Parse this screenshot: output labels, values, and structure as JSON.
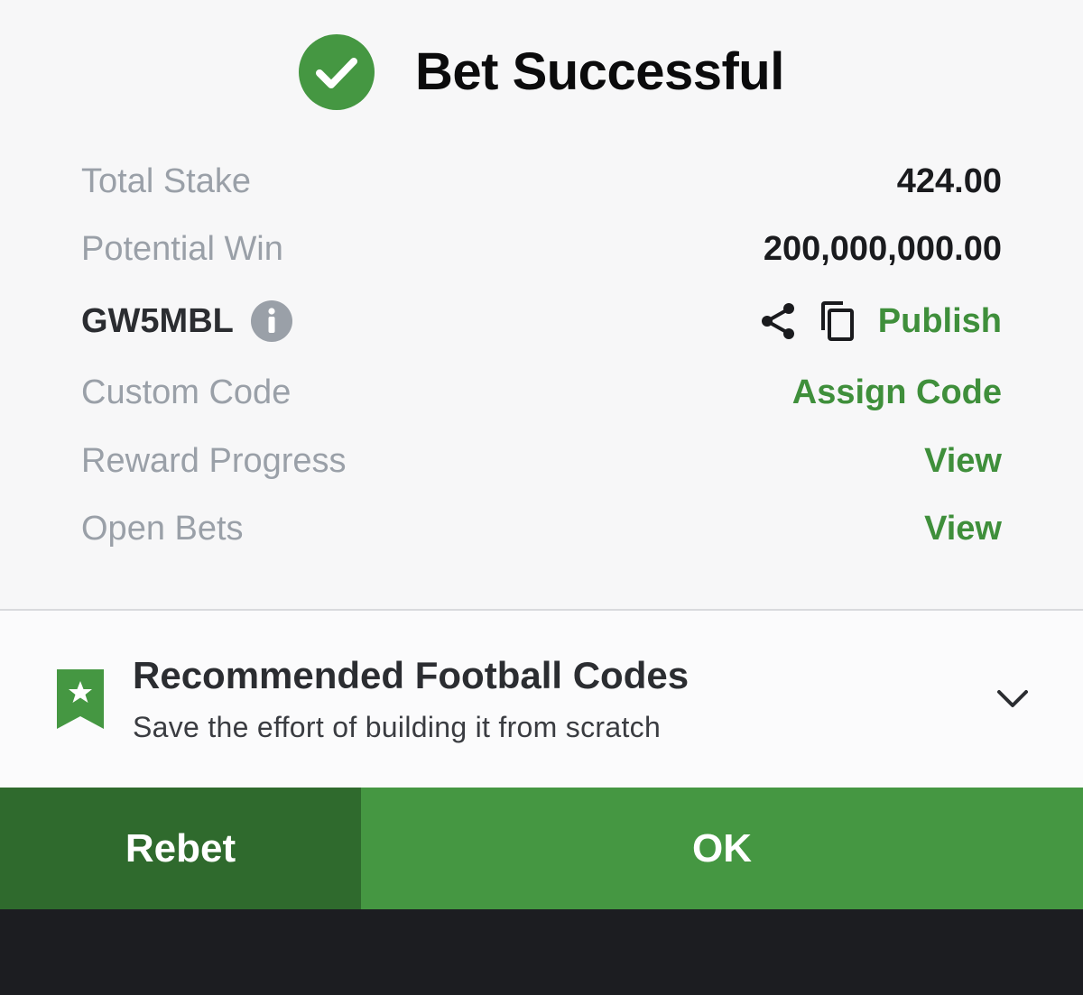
{
  "header": {
    "title": "Bet Successful",
    "icon": "check-circle-icon"
  },
  "details": {
    "total_stake": {
      "label": "Total Stake",
      "value": "424.00"
    },
    "potential_win": {
      "label": "Potential Win",
      "value": "200,000,000.00"
    },
    "booking_code": {
      "code": "GW5MBL",
      "info_icon": "info-icon",
      "share_icon": "share-icon",
      "copy_icon": "copy-icon",
      "publish_label": "Publish"
    },
    "custom_code": {
      "label": "Custom Code",
      "action": "Assign Code"
    },
    "reward_progress": {
      "label": "Reward Progress",
      "action": "View"
    },
    "open_bets": {
      "label": "Open Bets",
      "action": "View"
    }
  },
  "recommended": {
    "title": "Recommended Football Codes",
    "subtitle": "Save the effort of building it from scratch",
    "icon": "bookmark-star-icon",
    "chevron": "chevron-down-icon"
  },
  "actions": {
    "rebet_label": "Rebet",
    "ok_label": "OK"
  },
  "colors": {
    "accent_green": "#459742",
    "dark_green": "#2f6a2d",
    "text_green": "#3f8f3b",
    "label_gray": "#9aa0a8",
    "background": "#f7f7f8",
    "bottom_bar": "#1c1d21"
  }
}
